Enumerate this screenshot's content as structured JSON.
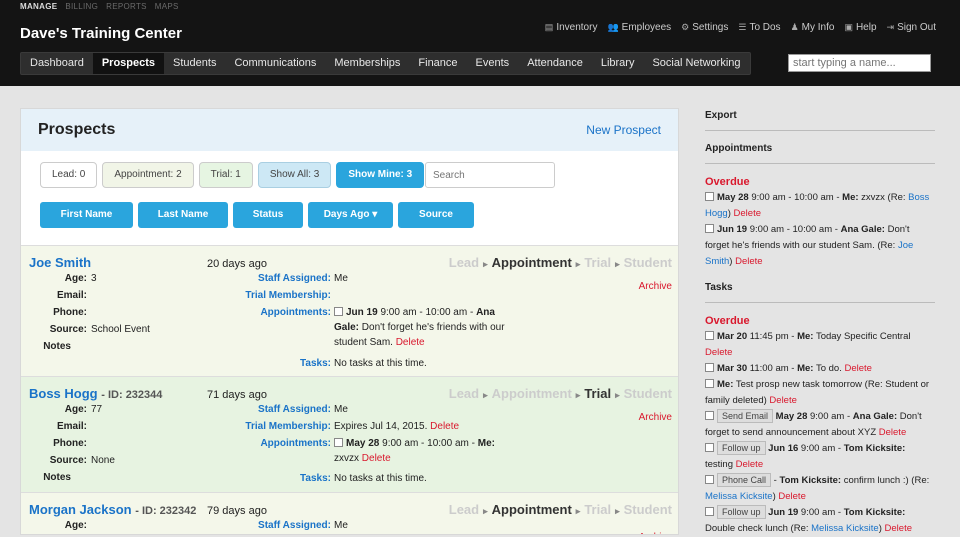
{
  "topnav": [
    "MANAGE",
    "BILLING",
    "REPORTS",
    "MAPS"
  ],
  "app_name": "Dave's Training Center",
  "utils": [
    {
      "icon": "inventory-icon",
      "glyph": "▤",
      "label": "Inventory"
    },
    {
      "icon": "employees-icon",
      "glyph": "👥",
      "label": "Employees"
    },
    {
      "icon": "settings-icon",
      "glyph": "⚙",
      "label": "Settings"
    },
    {
      "icon": "todos-icon",
      "glyph": "☰",
      "label": "To Dos"
    },
    {
      "icon": "user-icon",
      "glyph": "♟",
      "label": "My Info"
    },
    {
      "icon": "help-icon",
      "glyph": "▣",
      "label": "Help"
    },
    {
      "icon": "signout-icon",
      "glyph": "⇥",
      "label": "Sign Out"
    }
  ],
  "mainnav": [
    "Dashboard",
    "Prospects",
    "Students",
    "Communications",
    "Memberships",
    "Finance",
    "Events",
    "Attendance",
    "Library",
    "Social Networking"
  ],
  "mainnav_active": "Prospects",
  "name_search_placeholder": "start typing a name...",
  "panel": {
    "title": "Prospects",
    "new_label": "New Prospect"
  },
  "filters": {
    "lead": "Lead: 0",
    "appointment": "Appointment: 2",
    "trial": "Trial: 1",
    "all": "Show All: 3",
    "mine": "Show Mine: 3",
    "search_placeholder": "Search"
  },
  "sorts": {
    "first": "First Name",
    "last": "Last Name",
    "status": "Status",
    "days": "Days Ago",
    "days_caret": "▾",
    "source": "Source"
  },
  "labels": {
    "age": "Age:",
    "email": "Email:",
    "phone": "Phone:",
    "source": "Source:",
    "notes": "Notes",
    "staff": "Staff Assigned:",
    "trial": "Trial Membership:",
    "appointments": "Appointments:",
    "tasks": "Tasks:",
    "archive": "Archive",
    "delete": "Delete"
  },
  "pipeline": {
    "lead": "Lead",
    "appointment": "Appointment",
    "trial": "Trial",
    "student": "Student",
    "arrow": "▸"
  },
  "records": [
    {
      "name": "Joe Smith",
      "id": "",
      "days": "20 days ago",
      "age": "3",
      "source_value": "School Event",
      "staff": "Me",
      "trial": "",
      "appt_date": "Jun 19",
      "appt_text": " 9:00 am - 10:00 am - ",
      "appt_who": "Ana",
      "appt_line2": "Gale:",
      "appt_rest": " Don't forget he's friends with our",
      "appt_line3": "student Sam. ",
      "tasks": "No tasks at this time.",
      "stage": "Appointment"
    },
    {
      "name": "Boss Hogg",
      "id": "- ID: 232344",
      "days": "71 days ago",
      "age": "77",
      "source_value": "None",
      "staff": "Me",
      "trial": "Expires Jul 14, 2015. ",
      "appt_date": "May 28",
      "appt_text": " 9:00 am - 10:00 am - ",
      "appt_who": "Me:",
      "appt_line2": "",
      "appt_rest": "",
      "appt_line3": "zxvzx ",
      "tasks": "No tasks at this time.",
      "stage": "Trial"
    },
    {
      "name": "Morgan Jackson",
      "id": "- ID: 232342",
      "days": "79 days ago",
      "age": "",
      "staff": "Me",
      "stage": "Appointment"
    }
  ],
  "side": {
    "export": "Export",
    "appointments": "Appointments",
    "overdue": "Overdue",
    "appt_items": [
      {
        "date": "May 28",
        "pre": " 9:00 am - 10:00 am - ",
        "who": "Me:",
        "text": " zxvzx (Re: ",
        "link": "Boss Hogg",
        "post": ") "
      },
      {
        "date": "Jun 19",
        "pre": " 9:00 am - 10:00 am - ",
        "who": "Ana Gale:",
        "text": " Don't forget he's friends with our student Sam. (Re: ",
        "link": "Joe Smith",
        "post": ") "
      }
    ],
    "tasks": "Tasks",
    "task_items": [
      {
        "tag": "",
        "date": "Mar 20",
        "pre": " 11:45 pm - ",
        "who": "Me:",
        "text": " Today Specific Central ",
        "link": "",
        "post": ""
      },
      {
        "tag": "",
        "date": "Mar 30",
        "pre": " 11:00 am - ",
        "who": "Me:",
        "text": " To do. ",
        "link": "",
        "post": ""
      },
      {
        "tag": "",
        "date": "",
        "pre": "",
        "who": "Me:",
        "text": " Test prosp new task tomorrow (Re: Student or family deleted) ",
        "link": "",
        "post": ""
      },
      {
        "tag": "Send Email",
        "date": "May 28",
        "pre": " 9:00 am - ",
        "who": "Ana Gale:",
        "text": " Don't forget to send announcement about XYZ ",
        "link": "",
        "post": ""
      },
      {
        "tag": "Follow up",
        "date": "Jun 16",
        "pre": " 9:00 am - ",
        "who": "Tom Kicksite:",
        "text": " testing ",
        "link": "",
        "post": ""
      },
      {
        "tag": "Phone Call",
        "date": "",
        "pre": " - ",
        "who": "Tom Kicksite:",
        "text": " confirm lunch :) (Re: ",
        "link": "Melissa Kicksite",
        "post": ") "
      },
      {
        "tag": "Follow up",
        "date": "Jun 19",
        "pre": " 9:00 am - ",
        "who": "Tom Kicksite:",
        "text": " Double check lunch (Re: ",
        "link": "Melissa Kicksite",
        "post": ") "
      }
    ]
  }
}
